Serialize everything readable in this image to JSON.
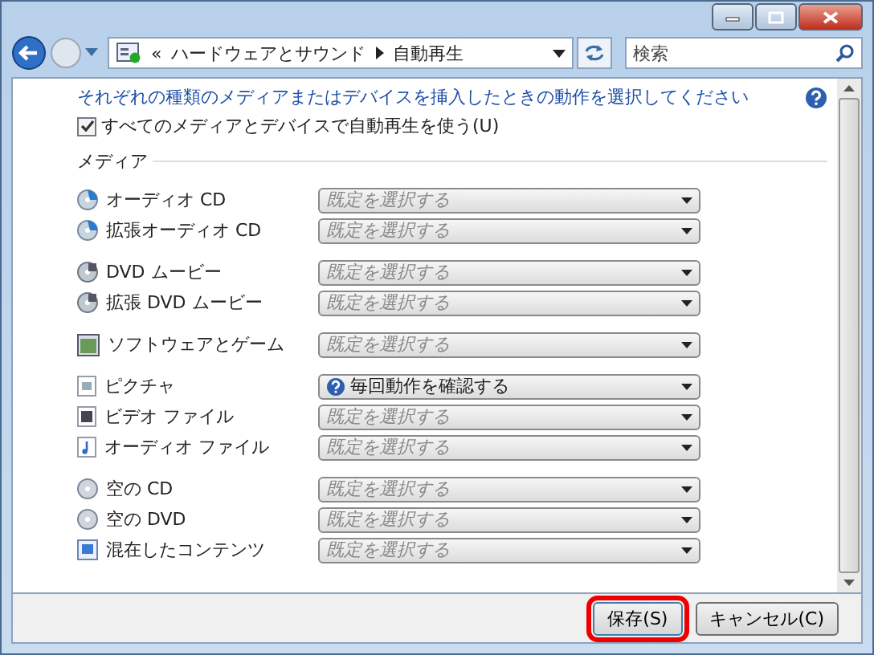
{
  "address_bar": {
    "prefix": "«",
    "segments": [
      "ハードウェアとサウンド",
      "自動再生"
    ]
  },
  "search": {
    "placeholder": "検索"
  },
  "instruction": "それぞれの種類のメディアまたはデバイスを挿入したときの動作を選択してください",
  "autoplay_checkbox": {
    "label": "すべてのメディアとデバイスで自動再生を使う(U)",
    "checked": true
  },
  "section_title": "メディア",
  "groups": [
    [
      {
        "label": "オーディオ CD",
        "kind": "cd",
        "select": {
          "kind": "placeholder",
          "value": "既定を選択する"
        }
      },
      {
        "label": "拡張オーディオ CD",
        "kind": "cd",
        "select": {
          "kind": "placeholder",
          "value": "既定を選択する"
        }
      }
    ],
    [
      {
        "label": "DVD ムービー",
        "kind": "dvd",
        "select": {
          "kind": "placeholder",
          "value": "既定を選択する"
        }
      },
      {
        "label": "拡張 DVD ムービー",
        "kind": "dvd",
        "select": {
          "kind": "placeholder",
          "value": "既定を選択する"
        }
      }
    ],
    [
      {
        "label": "ソフトウェアとゲーム",
        "kind": "software",
        "select": {
          "kind": "placeholder",
          "value": "既定を選択する"
        }
      }
    ],
    [
      {
        "label": "ピクチャ",
        "kind": "picture",
        "select": {
          "kind": "ask",
          "value": "毎回動作を確認する"
        }
      },
      {
        "label": "ビデオ ファイル",
        "kind": "video",
        "select": {
          "kind": "placeholder",
          "value": "既定を選択する"
        }
      },
      {
        "label": "オーディオ ファイル",
        "kind": "audio",
        "select": {
          "kind": "placeholder",
          "value": "既定を選択する"
        }
      }
    ],
    [
      {
        "label": "空の CD",
        "kind": "blank",
        "select": {
          "kind": "placeholder",
          "value": "既定を選択する"
        }
      },
      {
        "label": "空の DVD",
        "kind": "blank",
        "select": {
          "kind": "placeholder",
          "value": "既定を選択する"
        }
      },
      {
        "label": "混在したコンテンツ",
        "kind": "mixed",
        "select": {
          "kind": "placeholder",
          "value": "既定を選択する"
        }
      }
    ]
  ],
  "buttons": [
    {
      "label": "保存(S)",
      "highlighted": true
    },
    {
      "label": "キャンセル(C)",
      "highlighted": false
    }
  ]
}
